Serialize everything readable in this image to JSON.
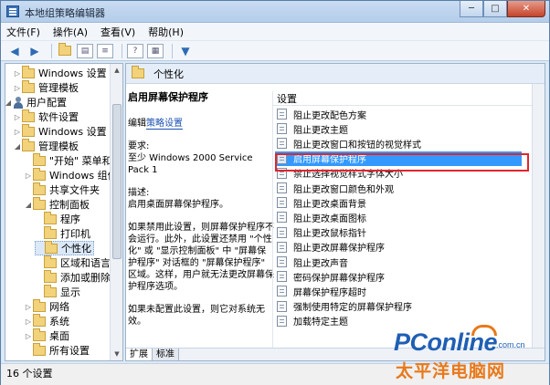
{
  "window": {
    "title": "本地组策略编辑器",
    "min": "─",
    "max": "□",
    "close": "✕"
  },
  "menu": [
    "文件(F)",
    "操作(A)",
    "查看(V)",
    "帮助(H)"
  ],
  "tree": [
    {
      "label": "Windows 设置",
      "arrow": "▷"
    },
    {
      "label": "管理模板",
      "arrow": "▷"
    },
    {
      "label": "用户配置",
      "arrow": "◢"
    },
    {
      "label": "软件设置",
      "arrow": "▷"
    },
    {
      "label": "Windows 设置",
      "arrow": "▷"
    },
    {
      "label": "管理模板",
      "arrow": "◢"
    },
    {
      "label": "\"开始\" 菜单和",
      "arrow": ""
    },
    {
      "label": "Windows 组件",
      "arrow": "▷"
    },
    {
      "label": "共享文件夹",
      "arrow": ""
    },
    {
      "label": "控制面板",
      "arrow": "◢"
    },
    {
      "label": "程序",
      "arrow": ""
    },
    {
      "label": "打印机",
      "arrow": ""
    },
    {
      "label": "个性化",
      "arrow": ""
    },
    {
      "label": "区域和语言",
      "arrow": ""
    },
    {
      "label": "添加或删除",
      "arrow": ""
    },
    {
      "label": "显示",
      "arrow": ""
    },
    {
      "label": "网络",
      "arrow": "▷"
    },
    {
      "label": "系统",
      "arrow": "▷"
    },
    {
      "label": "桌面",
      "arrow": "▷"
    },
    {
      "label": "所有设置",
      "arrow": ""
    }
  ],
  "right": {
    "header": "个性化",
    "desc": {
      "title": "启用屏幕保护程序",
      "edit_prefix": "编辑",
      "edit_link": "策略设置",
      "req_label": "要求:",
      "req_text": "至少 Windows 2000 Service Pack 1",
      "desc_label": "描述:",
      "desc_text": "启用桌面屏幕保护程序。",
      "para1": "如果禁用此设置，则屏幕保护程序不会运行。此外，此设置还禁用 \"个性化\" 或 \"显示控制面板\" 中 \"屏幕保护程序\" 对话框的 \"屏幕保护程序\" 区域。这样，用户就无法更改屏幕保护程序选项。",
      "para2": "如果未配置此设置，则它对系统无效。"
    },
    "column": "设置",
    "settings": [
      "阻止更改配色方案",
      "阻止更改主题",
      "阻止更改窗口和按钮的视觉样式",
      "启用屏幕保护程序",
      "禁止选择视觉样式字体大小",
      "阻止更改窗口颜色和外观",
      "阻止更改桌面背景",
      "阻止更改桌面图标",
      "阻止更改鼠标指针",
      "阻止更改屏幕保护程序",
      "阻止更改声音",
      "密码保护屏幕保护程序",
      "屏幕保护程序超时",
      "强制使用特定的屏幕保护程序",
      "加载特定主题"
    ],
    "selected_index": 3,
    "tabs": [
      "扩展",
      "标准"
    ]
  },
  "status": "16 个设置",
  "watermark": {
    "main": "PConline",
    "domain": ".com.cn",
    "cn": "太平洋电脑网"
  }
}
